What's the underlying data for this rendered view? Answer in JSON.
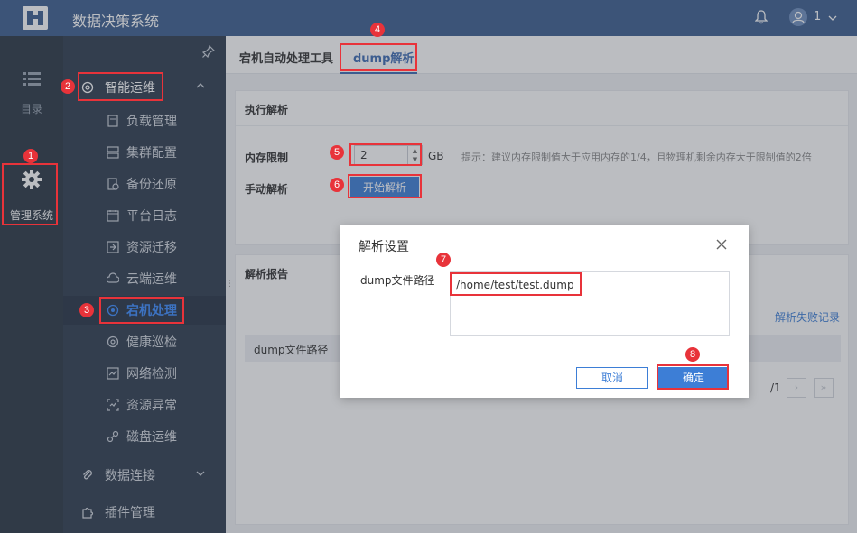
{
  "app": {
    "title": "数据决策系统"
  },
  "topbar": {
    "user_name": "1"
  },
  "rail": {
    "items": [
      {
        "label": "目录",
        "icon": "list-icon"
      },
      {
        "label": "管理系统",
        "icon": "gear-icon"
      }
    ]
  },
  "sidebar": {
    "group_ops": {
      "label": "智能运维",
      "icon": "ops-icon"
    },
    "items": [
      {
        "label": "负载管理"
      },
      {
        "label": "集群配置"
      },
      {
        "label": "备份还原"
      },
      {
        "label": "平台日志"
      },
      {
        "label": "资源迁移"
      },
      {
        "label": "云端运维"
      },
      {
        "label": "宕机处理"
      },
      {
        "label": "健康巡检"
      },
      {
        "label": "网络检测"
      },
      {
        "label": "资源异常"
      },
      {
        "label": "磁盘运维"
      }
    ],
    "group_data": {
      "label": "数据连接"
    },
    "group_plugin": {
      "label": "插件管理"
    }
  },
  "tabs": [
    {
      "label": "宕机自动处理工具"
    },
    {
      "label": "dump解析"
    }
  ],
  "exec_card": {
    "title": "执行解析",
    "mem_label": "内存限制",
    "mem_value": "2",
    "mem_unit": "GB",
    "hint": "提示：建议内存限制值大于应用内存的1/4，且物理机剩余内存大于限制值的2倍",
    "manual_label": "手动解析",
    "start_button": "开始解析"
  },
  "report_card": {
    "title": "解析报告",
    "fail_link": "解析失败记录",
    "column_path": "dump文件路径",
    "pager_total": "/1"
  },
  "dialog": {
    "title": "解析设置",
    "path_label": "dump文件路径",
    "path_value": "/home/test/test.dump",
    "cancel": "取消",
    "ok": "确定"
  },
  "steps": [
    "1",
    "2",
    "3",
    "4",
    "5",
    "6",
    "7",
    "8"
  ],
  "colors": {
    "topbar": "#3d5f8f",
    "rail": "#2a3644",
    "sidebar": "#2f3d4f",
    "accent": "#3d7ed6",
    "annotation": "#e8333a"
  }
}
